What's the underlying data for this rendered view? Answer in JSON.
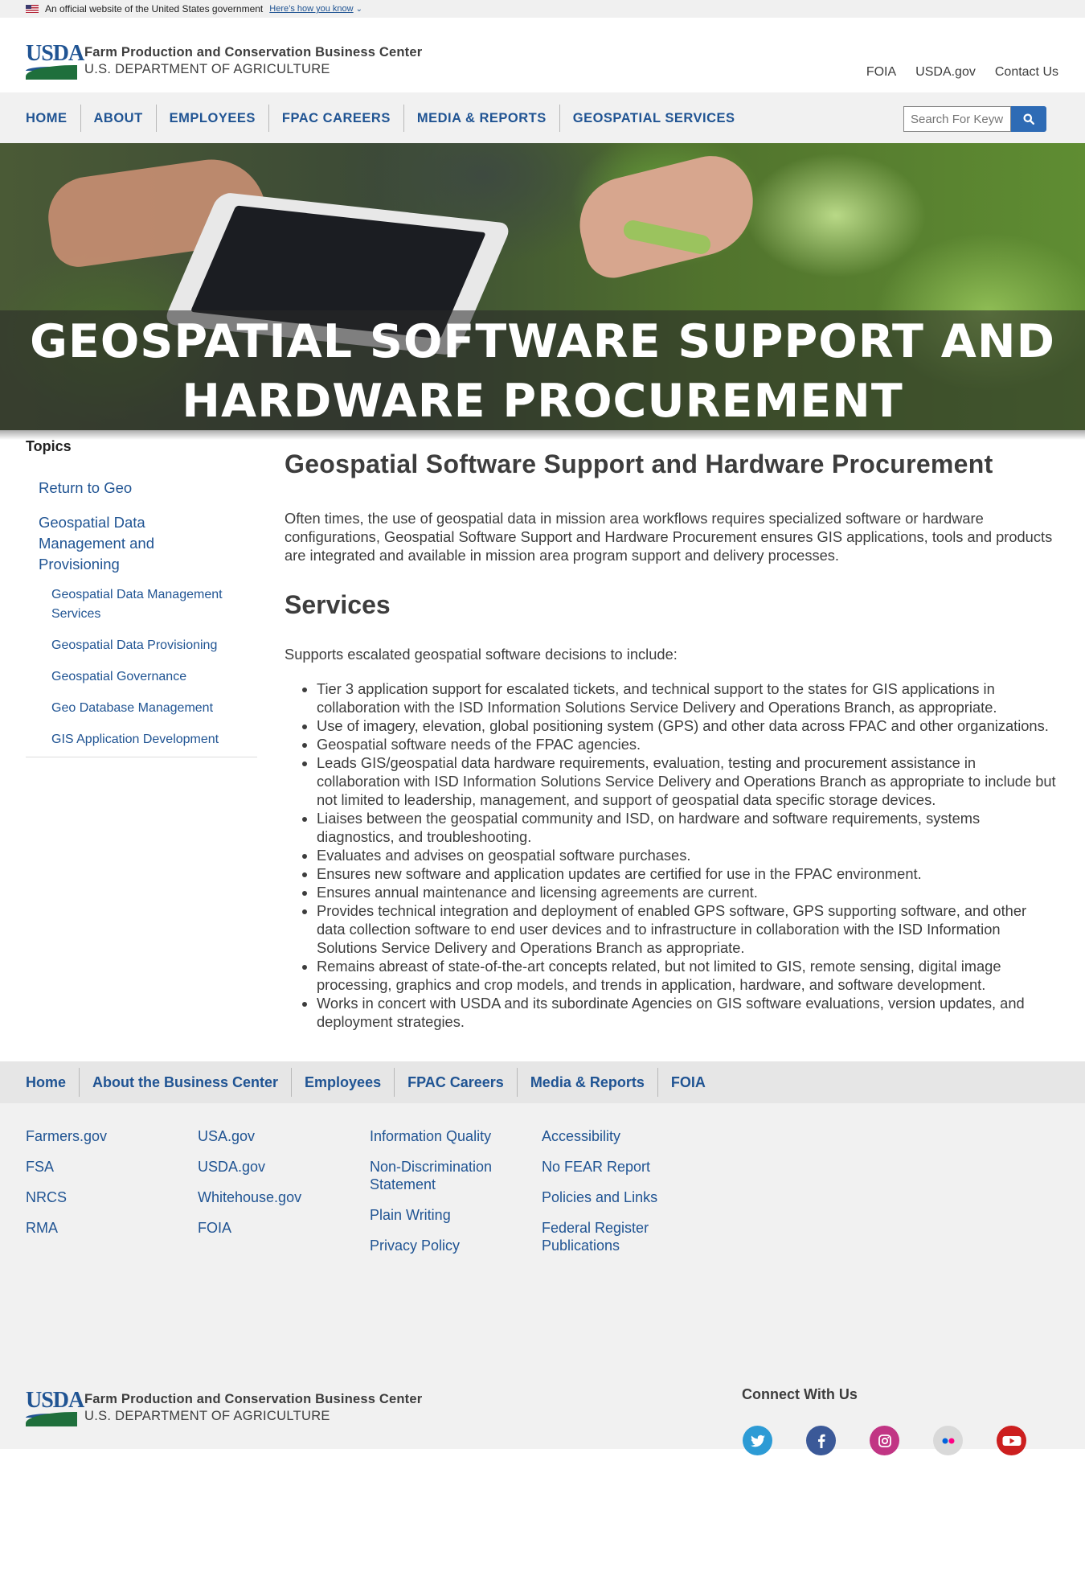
{
  "gov_banner": {
    "text": "An official website of the United States government",
    "link": "Here’s how you know"
  },
  "header": {
    "logo_text": "USDA",
    "org_name": "Farm Production and Conservation Business Center",
    "dept_name": "U.S. DEPARTMENT OF AGRICULTURE",
    "utility_links": [
      "FOIA",
      "USDA.gov",
      "Contact Us"
    ]
  },
  "nav": {
    "items": [
      "HOME",
      "ABOUT",
      "EMPLOYEES",
      "FPAC CAREERS",
      "MEDIA & REPORTS",
      "GEOSPATIAL SERVICES"
    ],
    "search_placeholder": "Search For Keyw"
  },
  "hero": {
    "title_line1": "GEOSPATIAL SOFTWARE SUPPORT AND",
    "title_line2": "HARDWARE PROCUREMENT"
  },
  "sidebar": {
    "heading": "Topics",
    "top_links": [
      "Return to Geo",
      "Geospatial Data Management and Provisioning"
    ],
    "sub_links": [
      "Geospatial Data Management Services",
      "Geospatial Data Provisioning",
      "Geospatial Governance",
      "Geo Database Management",
      "GIS Application Development"
    ]
  },
  "main": {
    "title": "Geospatial Software Support and Hardware Procurement",
    "intro": "Often times, the use of geospatial data in mission area workflows requires specialized software or hardware configurations, Geospatial Software Support and Hardware Procurement ensures GIS applications, tools and products are integrated and available in mission area program support and delivery processes.",
    "services_heading": "Services",
    "services_lead": "Supports escalated geospatial software decisions to include:",
    "services": [
      "Tier 3 application support for escalated tickets, and technical support to the states for GIS applications in collaboration with the ISD Information Solutions Service Delivery and Operations Branch, as appropriate.",
      "Use of imagery, elevation, global positioning system (GPS) and other data across FPAC and other organizations.",
      "Geospatial software needs of the FPAC agencies.",
      "Leads GIS/geospatial data hardware requirements, evaluation, testing and procurement assistance in collaboration with ISD Information Solutions Service Delivery and Operations Branch as appropriate to include but not limited to leadership, management, and support of geospatial data specific storage devices.",
      "Liaises between the geospatial community and ISD, on hardware and software requirements, systems diagnostics, and troubleshooting.",
      "Evaluates and advises on geospatial software purchases.",
      "Ensures new software and application updates are certified for use in the FPAC environment.",
      "Ensures annual maintenance and licensing agreements are current.",
      "Provides technical integration and deployment of enabled GPS software, GPS supporting software, and other data collection software to end user devices and to infrastructure in collaboration with the ISD Information Solutions Service Delivery and Operations Branch as appropriate.",
      "Remains abreast of state-of-the-art concepts related, but not limited to GIS, remote sensing, digital image processing, graphics and crop models, and trends in application, hardware, and software development.",
      "Works in concert with USDA and its subordinate Agencies on GIS software evaluations, version updates, and deployment strategies."
    ]
  },
  "footer_nav": [
    "Home",
    "About the Business Center",
    "Employees",
    "FPAC Careers",
    "Media & Reports",
    "FOIA"
  ],
  "footer_links": {
    "col1": [
      "Farmers.gov",
      "FSA",
      "NRCS",
      "RMA"
    ],
    "col2": [
      "USA.gov",
      "USDA.gov",
      "Whitehouse.gov",
      "FOIA"
    ],
    "col3": [
      "Information Quality",
      "Non-Discrimination Statement",
      "Plain Writing",
      "Privacy Policy"
    ],
    "col4": [
      "Accessibility",
      "No FEAR Report",
      "Policies and Links",
      "Federal Register Publications"
    ]
  },
  "connect": {
    "heading": "Connect With Us",
    "icons": [
      "twitter-icon",
      "facebook-icon",
      "instagram-icon",
      "flickr-icon",
      "youtube-icon"
    ],
    "colors": {
      "twitter": "#2d9bd5",
      "facebook": "#3b5998",
      "instagram": "#c13584",
      "flickr": "#d9d9d9",
      "youtube": "#cc1f1f"
    }
  },
  "colors": {
    "link": "#205493",
    "nav_bg": "#f1f1f1",
    "search_button": "#2e6bb5",
    "usda_green": "#1f6f3c"
  }
}
